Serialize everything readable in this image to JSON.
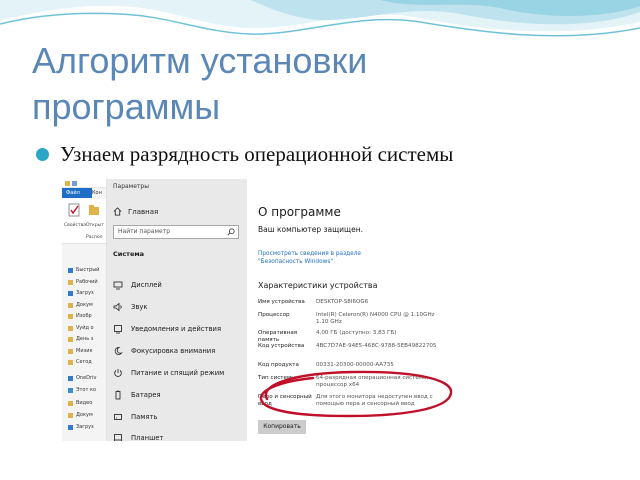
{
  "slide": {
    "title": "Алгоритм установки программы",
    "bullet": "Узнаем разрядность операционной системы",
    "accent_color": "#5a87b6",
    "bullet_color": "#2aa7c6",
    "highlight_color": "#c0102a"
  },
  "explorer": {
    "tab_label": "Файл",
    "tab2_label": "Кон",
    "ribbon_labels": [
      "Свойства",
      "Открыт",
      "Распол"
    ],
    "nav_items": [
      {
        "label": "Быстрый",
        "icon": "star-icon"
      },
      {
        "label": "Рабочий",
        "icon": "folder-icon"
      },
      {
        "label": "Загруз",
        "icon": "download-icon"
      },
      {
        "label": "Докум",
        "icon": "folder-icon"
      },
      {
        "label": "Изобр",
        "icon": "folder-icon"
      },
      {
        "label": "Vyйд о",
        "icon": "folder-icon"
      },
      {
        "label": "День з",
        "icon": "folder-icon"
      },
      {
        "label": "Мизик",
        "icon": "folder-icon"
      },
      {
        "label": "Сегод",
        "icon": "folder-icon"
      },
      {
        "label": "OneDriv",
        "icon": "cloud-icon"
      },
      {
        "label": "Этот ко",
        "icon": "computer-icon"
      },
      {
        "label": "Видео",
        "icon": "folder-icon"
      },
      {
        "label": "Докум",
        "icon": "folder-icon"
      },
      {
        "label": "Загруз",
        "icon": "download-icon"
      }
    ]
  },
  "settings": {
    "window_title": "Параметры",
    "home_label": "Главная",
    "search_placeholder": "Найти параметр",
    "section_label": "Система",
    "items": [
      {
        "label": "Дисплей",
        "icon": "display-icon"
      },
      {
        "label": "Звук",
        "icon": "sound-icon"
      },
      {
        "label": "Уведомления и действия",
        "icon": "notifications-icon"
      },
      {
        "label": "Фокусировка внимания",
        "icon": "moon-icon"
      },
      {
        "label": "Питание и спящий режим",
        "icon": "power-icon"
      },
      {
        "label": "Батарея",
        "icon": "battery-icon"
      },
      {
        "label": "Память",
        "icon": "storage-icon"
      },
      {
        "label": "Планшет",
        "icon": "tablet-icon"
      }
    ]
  },
  "about": {
    "heading": "О программе",
    "protection_status": "Ваш компьютер защищен.",
    "security_link": "Просмотреть сведения в разделе \"Безопасность Windows\"",
    "specs_heading": "Характеристики устройства",
    "specs": [
      {
        "key": "Имя устройства",
        "value": "DESKTOP-S8I6OG6"
      },
      {
        "key": "Процессор",
        "value": "Intel(R) Celeron(R) N4000 CPU @ 1.10GHz 1.10 GHz"
      },
      {
        "key": "Оперативная память",
        "value": "4,00 ГБ (доступно: 3,83 ГБ)"
      },
      {
        "key": "Код устройства",
        "value": "4BC7D7AE-94E5-468C-9788-5EB49822705"
      },
      {
        "key": "Код продукта",
        "value": "00331-20300-00000-AA735"
      },
      {
        "key": "Тип системы",
        "value": "64-разрядная операционная система, процессор x64"
      },
      {
        "key": "Перо и сенсорный ввод",
        "value": "Для этого монитора недоступен ввод с помощью пера и сенсорный ввод"
      }
    ],
    "copy_button": "Копировать"
  }
}
